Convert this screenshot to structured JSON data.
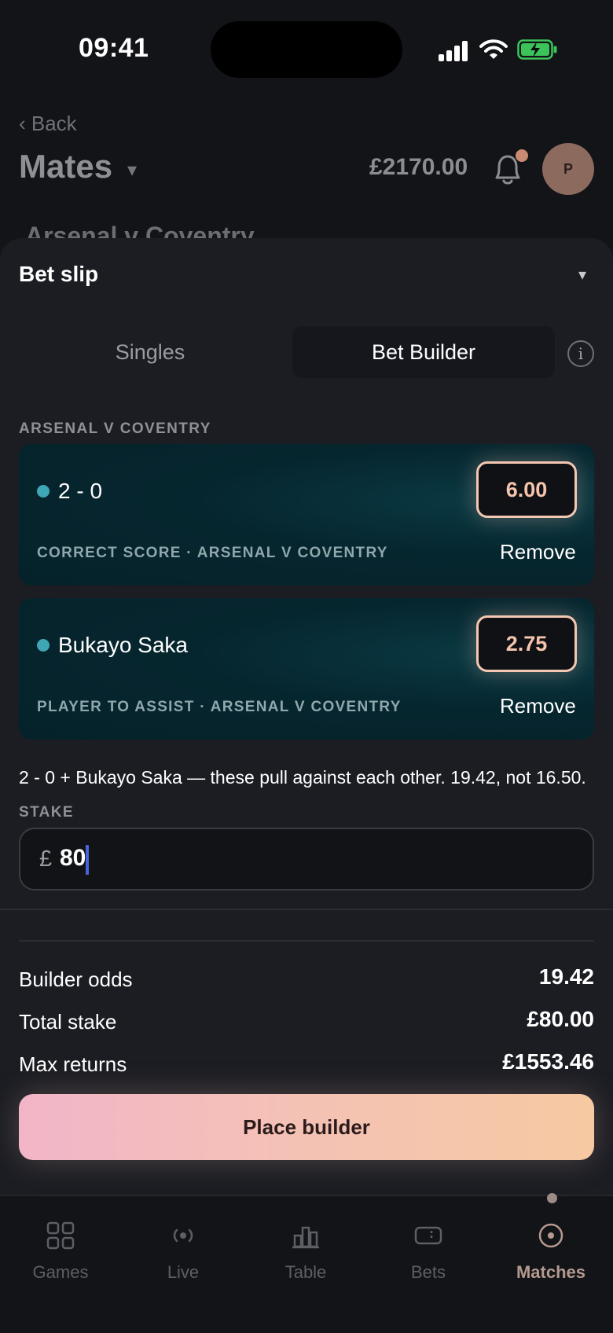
{
  "status_bar": {
    "time": "09:41"
  },
  "header": {
    "back_label": "‹ Back",
    "league_title": "Mates",
    "league_caret": "▾",
    "balance": "£2170.00",
    "avatar_initial": "P",
    "peek_match_title": "Arsenal v Coventry"
  },
  "bet_slip": {
    "title": "Bet slip",
    "collapse_icon": "▾",
    "tabs": [
      {
        "label": "Singles",
        "selected": false
      },
      {
        "label": "Bet Builder",
        "selected": true
      }
    ],
    "info_icon": "i",
    "event_heading": "ARSENAL V COVENTRY",
    "selections": [
      {
        "name": "2 - 0",
        "odds": "6.00",
        "market": "CORRECT SCORE · ARSENAL V COVENTRY",
        "remove_label": "Remove"
      },
      {
        "name": "Bukayo Saka",
        "odds": "2.75",
        "market": "PLAYER TO ASSIST · ARSENAL V COVENTRY",
        "remove_label": "Remove"
      }
    ],
    "builder_note": "2 - 0 + Bukayo Saka — these pull against each other. 19.42, not 16.50.",
    "stake_label": "STAKE",
    "stake_currency": "£",
    "stake_value": "80",
    "summary": [
      {
        "label": "Builder odds",
        "value": "19.42"
      },
      {
        "label": "Total stake",
        "value": "£80.00"
      },
      {
        "label": "Max returns",
        "value": "£1553.46"
      }
    ],
    "place_button_label": "Place builder"
  },
  "bottom_nav": {
    "items": [
      {
        "label": "Games",
        "icon": "grid-icon",
        "active": false
      },
      {
        "label": "Live",
        "icon": "live-broadcast-icon",
        "active": false
      },
      {
        "label": "Table",
        "icon": "bar-chart-icon",
        "active": false
      },
      {
        "label": "Bets",
        "icon": "ticket-icon",
        "active": false
      },
      {
        "label": "Matches",
        "icon": "target-icon",
        "active": true
      }
    ]
  },
  "colors": {
    "background": "#121418",
    "sheet": "#1b1d23",
    "card": "#06262f",
    "accent_dot": "#3ea6b5",
    "odds_border": "#f3c7b2",
    "cta_gradient_start": "#f2b5c8",
    "cta_gradient_end": "#f6c9a2",
    "active_nav": "#b59a8f"
  }
}
